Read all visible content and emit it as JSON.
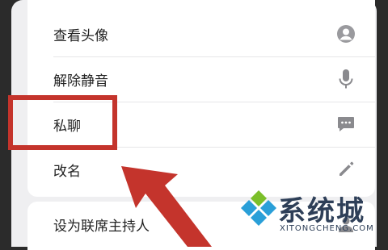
{
  "menu": {
    "items": [
      {
        "label": "查看头像",
        "icon": "avatar-icon"
      },
      {
        "label": "解除静音",
        "icon": "microphone-icon"
      },
      {
        "label": "私聊",
        "icon": "chat-bubble-icon"
      },
      {
        "label": "改名",
        "icon": "pencil-icon"
      }
    ],
    "secondary_items": [
      {
        "label": "设为联席主持人",
        "icon": "cohost-icon"
      }
    ]
  },
  "annotation": {
    "highlight_color": "#c4342c",
    "highlighted_item": "私聊"
  },
  "watermark": {
    "title": "系统城",
    "url": "XITONGCHENG.COM"
  },
  "colors": {
    "background": "#efeff1",
    "card": "#ffffff",
    "text": "#222222",
    "icon": "#8a8a8e",
    "brand_green": "#7bbf2a",
    "brand_blue": "#2a9fd8"
  }
}
